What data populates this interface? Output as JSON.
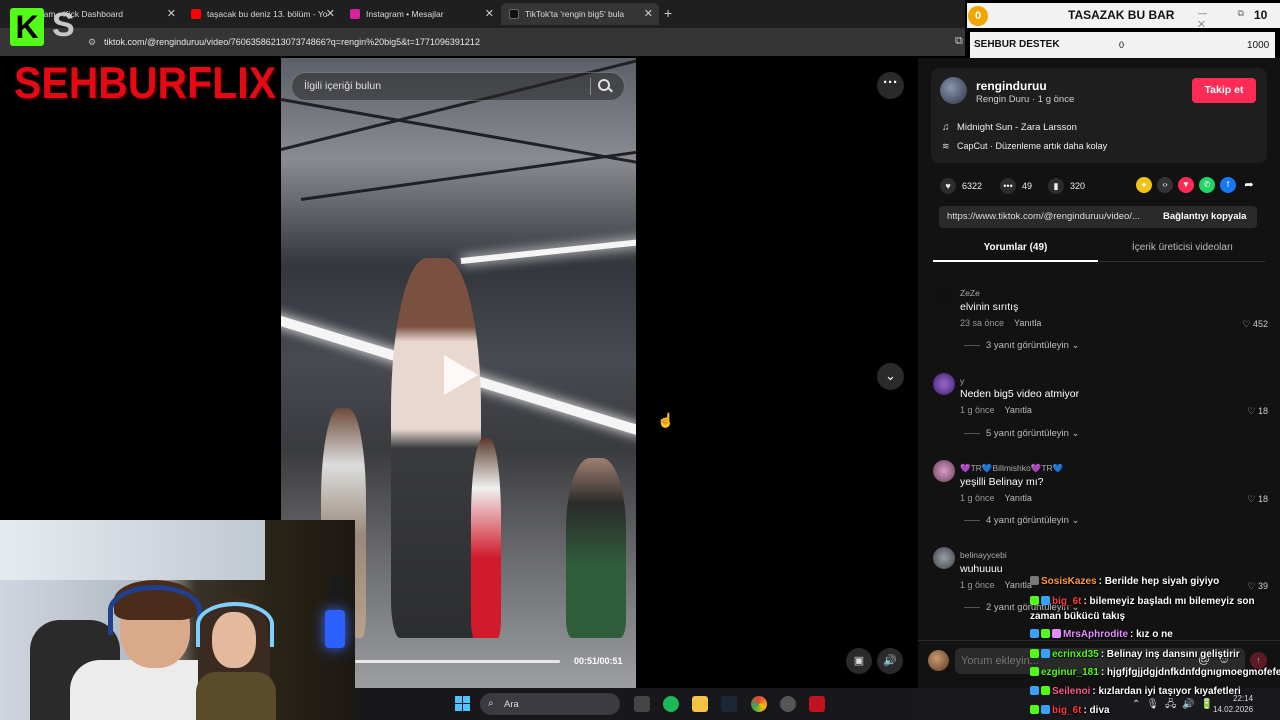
{
  "browser": {
    "tabs": [
      {
        "label": "Stream - Kick Dashboard",
        "color": "#53fc18"
      },
      {
        "label": "taşacak bu deniz 13. bölüm - Yo",
        "color": "#ff0000"
      },
      {
        "label": "Instagram • Mesajlar",
        "color": "#d6249f"
      },
      {
        "label": "TikTok'ta 'rengin big5' bula",
        "color": "#111111"
      }
    ],
    "new_tab": "+",
    "url": "tiktok.com/@renginduruu/video/7606358621307374866?q=rengin%20big5&t=1771096391212"
  },
  "overlay": {
    "kick_logo": "K",
    "kick_secondary": "S",
    "brand": "SEHBURFLIX"
  },
  "bar_widget": {
    "coin": "0",
    "title": "TASAZAK BU BAR",
    "count": "10",
    "controls": "— ⧉ ✕"
  },
  "destek_widget": {
    "label": "SEHBUR DESTEK",
    "min": "0",
    "max": "1000"
  },
  "video": {
    "search_placeholder": "İlgili içeriği bulun",
    "time": "00:51/00:51",
    "progress": 1.0
  },
  "post": {
    "author": "renginduruu",
    "subtitle": "Rengin Duru · 1 g önce",
    "follow": "Takip et",
    "music": "Midnight Sun - Zara Larsson",
    "capcut": "CapCut · Düzenleme artık daha kolay",
    "likes": "6322",
    "comments": "49",
    "saves": "320",
    "link": "https://www.tiktok.com/@renginduruu/video/...",
    "copy_link": "Bağlantıyı kopyala",
    "tab_comments": "Yorumlar (49)",
    "tab_creator": "İçerik üreticisi videoları"
  },
  "comments": [
    {
      "user": "ZeZe",
      "text": "elvinin sırıtış",
      "time": "23 sa önce",
      "reply": "Yanıtla",
      "likes": "452",
      "replies": "3 yanıt görüntüleyin",
      "avatar": "#111111"
    },
    {
      "user": "y",
      "text": "Neden big5 video atmiyor",
      "time": "1 g önce",
      "reply": "Yanıtla",
      "likes": "18",
      "replies": "5 yanıt görüntüleyin",
      "avatar": "#6b3fa0"
    },
    {
      "user": "💜TR💙Billmishko💜TR💙",
      "text": "yeşilli Belinay mı?",
      "time": "1 g önce",
      "reply": "Yanıtla",
      "likes": "18",
      "replies": "4 yanıt görüntüleyin",
      "avatar": "#b07aa8"
    },
    {
      "user": "belinayycebi",
      "text": "wuhuuuu",
      "time": "1 g önce",
      "reply": "Yanıtla",
      "likes": "39",
      "replies": "2 yanıt görüntüleyin",
      "avatar": "#6a6f78"
    }
  ],
  "comment_bar": {
    "placeholder": "Yorum ekleyin..."
  },
  "chat": [
    {
      "user": "SosisKazes",
      "user_color": "#ff9a3c",
      "text": ": Berilde hep siyah giyiyo"
    },
    {
      "user": "big_6t",
      "user_color": "#ff3b3b",
      "text": ": bilemeyiz başladı mı bilemeyiz son"
    },
    {
      "user": "",
      "user_color": "#ffffff",
      "text": "zaman bükücü takış"
    },
    {
      "user": "MrsAphrodite",
      "user_color": "#e58cff",
      "text": ": kız o ne"
    },
    {
      "user": "ecrinxd35",
      "user_color": "#53fc18",
      "text": ": Belinay inş dansını geliştirir"
    },
    {
      "user": "ezginur_181",
      "user_color": "#53fc18",
      "text": ": hjgfjfgjjdgjdnfkdnfdgnıgmoegmofefe"
    },
    {
      "user": "Seilenoi",
      "user_color": "#ff5a8a",
      "text": ": kızlardan iyi taşıyor kıyafetleri"
    },
    {
      "user": "big_6t",
      "user_color": "#ff3b3b",
      "text": ": diva"
    }
  ],
  "taskbar": {
    "search": "Ara",
    "time": "22:14",
    "date": "14.02.2026"
  }
}
